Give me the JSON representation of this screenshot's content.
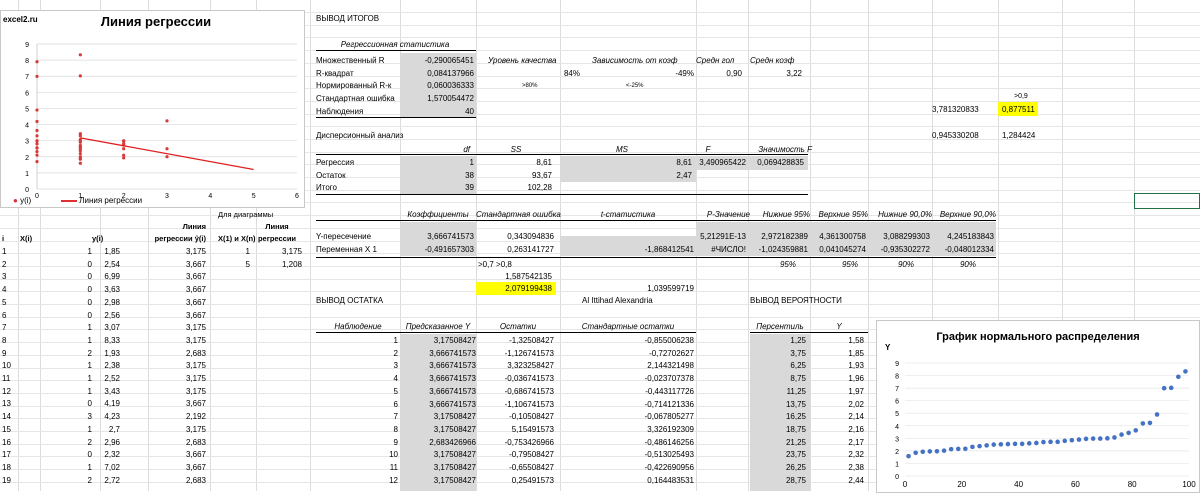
{
  "chart1": {
    "site": "excel2.ru",
    "title": "Линия регрессии",
    "legend_points": "y(i)",
    "legend_line": "Линия регрессии",
    "y_ticks": [
      "9",
      "8",
      "7",
      "6",
      "5",
      "4",
      "3",
      "2",
      "1",
      "0"
    ],
    "x_ticks": [
      "0",
      "1",
      "2",
      "3",
      "4",
      "5",
      "6"
    ]
  },
  "left_table": {
    "header_line1": [
      "",
      "",
      "",
      "Линия",
      "Для диаграммы",
      "Линия"
    ],
    "col_headers": [
      "i",
      "X(i)",
      "y(i)",
      "регрессии ŷ(i)",
      "X(1) и X(n)",
      "регрессии"
    ],
    "extra_header": "Для диаграммы",
    "diag_rows": [
      [
        "1",
        "3,175"
      ],
      [
        "5",
        "1,208"
      ]
    ],
    "rows": [
      [
        "1",
        "1",
        "1,85",
        "3,175"
      ],
      [
        "2",
        "0",
        "2,54",
        "3,667"
      ],
      [
        "3",
        "0",
        "6,99",
        "3,667"
      ],
      [
        "4",
        "0",
        "3,63",
        "3,667"
      ],
      [
        "5",
        "0",
        "2,98",
        "3,667"
      ],
      [
        "6",
        "0",
        "2,56",
        "3,667"
      ],
      [
        "7",
        "1",
        "3,07",
        "3,175"
      ],
      [
        "8",
        "1",
        "8,33",
        "3,175"
      ],
      [
        "9",
        "2",
        "1,93",
        "2,683"
      ],
      [
        "10",
        "1",
        "2,38",
        "3,175"
      ],
      [
        "11",
        "1",
        "2,52",
        "3,175"
      ],
      [
        "12",
        "1",
        "3,43",
        "3,175"
      ],
      [
        "13",
        "0",
        "4,19",
        "3,667"
      ],
      [
        "14",
        "3",
        "4,23",
        "2,192"
      ],
      [
        "15",
        "1",
        "2,7",
        "3,175"
      ],
      [
        "16",
        "2",
        "2,96",
        "2,683"
      ],
      [
        "17",
        "0",
        "2,32",
        "3,667"
      ],
      [
        "18",
        "1",
        "7,02",
        "3,667"
      ],
      [
        "19",
        "2",
        "2,72",
        "2,683"
      ]
    ]
  },
  "summary": {
    "title": "ВЫВОД ИТОГОВ",
    "reg_stats_header": "Регрессионная статистика",
    "rows": [
      [
        "Множественный R",
        "-0,290065451"
      ],
      [
        "R-квадрат",
        "0,084137966"
      ],
      [
        "Нормированный R-к",
        "0,060036333"
      ],
      [
        "Стандартная ошибка",
        "1,570054472"
      ],
      [
        "Наблюдения",
        "40"
      ]
    ],
    "extra_headers": [
      "Уровень качества",
      "Зависимость от коэф",
      "Средн гол",
      "Средн коэф"
    ],
    "extra_values": [
      "84%",
      "-49%",
      "0,90",
      "3,22"
    ],
    "extra_small": [
      ">80%",
      "<-25%"
    ],
    "side_a": ">0,9",
    "side_b1": "3,781320833",
    "side_b2": "0,877511",
    "side_c1": "0,945330208",
    "side_c2": "1,284424"
  },
  "anova": {
    "title": "Дисперсионный анализ",
    "headers": [
      "df",
      "SS",
      "MS",
      "F",
      "Значимость F"
    ],
    "rows": [
      [
        "Регрессия",
        "1",
        "8,61",
        "8,61",
        "3,490965422",
        "0,069428835"
      ],
      [
        "Остаток",
        "38",
        "93,67",
        "2,47",
        "",
        ""
      ],
      [
        "Итого",
        "39",
        "102,28",
        "",
        "",
        ""
      ]
    ]
  },
  "coef": {
    "headers": [
      "Коэффициенты",
      "Стандартная ошибка",
      "t-статистика",
      "P-Значение",
      "Нижние 95%",
      "Верхние 95%",
      "Нижние 90,0%",
      "Верхние 90,0%"
    ],
    "rows": [
      [
        "Y-пересечение",
        "3,666741573",
        "0,343094836",
        "",
        "5,21291E-13",
        "2,972182389",
        "4,361300758",
        "3,088299303",
        "4,245183843"
      ],
      [
        "Переменная X 1",
        "-0,491657303",
        "0,263141727",
        "-1,868412541",
        "#ЧИСЛО!",
        "-1,024359881",
        "0,041045274",
        "-0,935302272",
        "-0,048012334"
      ]
    ],
    "pct_row": [
      "95%",
      "95%",
      "90%",
      "90%"
    ],
    "note1": ">0,7  >0,8",
    "v1": "1,587542135",
    "v2": "2,079199438",
    "v3": "1,039599719",
    "company": "Al Ittihad Alexandria"
  },
  "residuals": {
    "title": "ВЫВОД ОСТАТКА",
    "headers": [
      "Наблюдение",
      "Предсказанное Y",
      "Остатки",
      "Стандартные остатки"
    ],
    "rows": [
      [
        "1",
        "3,17508427",
        "-1,32508427",
        "-0,855006238"
      ],
      [
        "2",
        "3,666741573",
        "-1,126741573",
        "-0,72702627"
      ],
      [
        "3",
        "3,666741573",
        "3,323258427",
        "2,144321498"
      ],
      [
        "4",
        "3,666741573",
        "-0,036741573",
        "-0,023707378"
      ],
      [
        "5",
        "3,666741573",
        "-0,686741573",
        "-0,443117726"
      ],
      [
        "6",
        "3,666741573",
        "-1,106741573",
        "-0,714121336"
      ],
      [
        "7",
        "3,17508427",
        "-0,10508427",
        "-0,067805277"
      ],
      [
        "8",
        "3,17508427",
        "5,15491573",
        "3,326192309"
      ],
      [
        "9",
        "2,683426966",
        "-0,753426966",
        "-0,486146256"
      ],
      [
        "10",
        "3,17508427",
        "-0,79508427",
        "-0,513025493"
      ],
      [
        "11",
        "3,17508427",
        "-0,65508427",
        "-0,422690956"
      ],
      [
        "12",
        "3,17508427",
        "0,25491573",
        "0,164483531"
      ]
    ]
  },
  "probability": {
    "title": "ВЫВОД ВЕРОЯТНОСТИ",
    "headers": [
      "Персентиль",
      "Y"
    ],
    "rows": [
      [
        "1,25",
        "1,58"
      ],
      [
        "3,75",
        "1,85"
      ],
      [
        "6,25",
        "1,93"
      ],
      [
        "8,75",
        "1,96"
      ],
      [
        "11,25",
        "1,97"
      ],
      [
        "13,75",
        "2,02"
      ],
      [
        "16,25",
        "2,14"
      ],
      [
        "18,75",
        "2,16"
      ],
      [
        "21,25",
        "2,17"
      ],
      [
        "23,75",
        "2,32"
      ],
      [
        "26,25",
        "2,38"
      ],
      [
        "28,75",
        "2,44"
      ]
    ]
  },
  "chart2": {
    "title": "График нормального распределения",
    "ylabel": "Y",
    "y_ticks": [
      "9",
      "8",
      "7",
      "6",
      "5",
      "4",
      "3",
      "2",
      "1",
      "0"
    ],
    "x_ticks": [
      "0",
      "20",
      "40",
      "60",
      "80",
      "100"
    ]
  },
  "chart_data": [
    {
      "type": "scatter",
      "title": "Линия регрессии",
      "series": [
        {
          "name": "y(i)",
          "points": [
            [
              1,
              1.85
            ],
            [
              0,
              2.54
            ],
            [
              0,
              6.99
            ],
            [
              0,
              3.63
            ],
            [
              0,
              2.98
            ],
            [
              0,
              2.56
            ],
            [
              1,
              3.07
            ],
            [
              1,
              8.33
            ],
            [
              2,
              1.93
            ],
            [
              1,
              2.38
            ],
            [
              1,
              2.52
            ],
            [
              1,
              3.43
            ],
            [
              0,
              4.19
            ],
            [
              3,
              4.23
            ],
            [
              1,
              2.7
            ],
            [
              2,
              2.96
            ],
            [
              0,
              2.32
            ],
            [
              1,
              7.02
            ],
            [
              2,
              2.72
            ],
            [
              0,
              1.7
            ],
            [
              0,
              2.1
            ],
            [
              0,
              2.8
            ],
            [
              0,
              3.3
            ],
            [
              0,
              4.9
            ],
            [
              0,
              7.9
            ],
            [
              1,
              1.6
            ],
            [
              1,
              2.0
            ],
            [
              1,
              2.2
            ],
            [
              1,
              3.0
            ],
            [
              1,
              3.3
            ],
            [
              2,
              2.1
            ],
            [
              2,
              2.5
            ],
            [
              2,
              2.8
            ],
            [
              3,
              2.0
            ],
            [
              3,
              2.5
            ],
            [
              1,
              2.9
            ],
            [
              0,
              3.0
            ],
            [
              1,
              1.9
            ],
            [
              2,
              3.0
            ],
            [
              1,
              2.6
            ]
          ]
        },
        {
          "name": "Линия регрессии",
          "line": [
            [
              1,
              3.175
            ],
            [
              5,
              1.208
            ]
          ]
        }
      ],
      "xlim": [
        0,
        6
      ],
      "ylim": [
        0,
        9
      ]
    },
    {
      "type": "scatter",
      "title": "График нормального распределения",
      "ylabel": "Y",
      "x": [
        1.25,
        3.75,
        6.25,
        8.75,
        11.25,
        13.75,
        16.25,
        18.75,
        21.25,
        23.75,
        26.25,
        28.75,
        31.25,
        33.75,
        36.25,
        38.75,
        41.25,
        43.75,
        46.25,
        48.75,
        51.25,
        53.75,
        56.25,
        58.75,
        61.25,
        63.75,
        66.25,
        68.75,
        71.25,
        73.75,
        76.25,
        78.75,
        81.25,
        83.75,
        86.25,
        88.75,
        91.25,
        93.75,
        96.25,
        98.75
      ],
      "y": [
        1.58,
        1.85,
        1.93,
        1.96,
        1.97,
        2.02,
        2.14,
        2.16,
        2.17,
        2.32,
        2.38,
        2.44,
        2.5,
        2.52,
        2.54,
        2.56,
        2.56,
        2.6,
        2.63,
        2.7,
        2.72,
        2.72,
        2.8,
        2.85,
        2.9,
        2.96,
        2.98,
        2.98,
        3.0,
        3.07,
        3.3,
        3.43,
        3.63,
        4.19,
        4.23,
        4.9,
        6.99,
        7.02,
        7.9,
        8.33
      ],
      "xlim": [
        0,
        100
      ],
      "ylim": [
        0,
        9
      ]
    }
  ]
}
